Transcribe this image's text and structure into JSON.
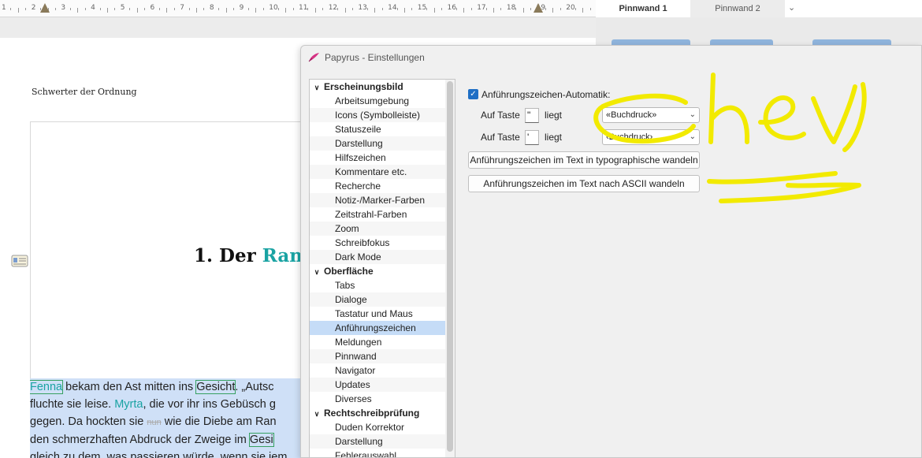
{
  "ruler": {
    "labels": [
      "1",
      "2",
      "3",
      "4",
      "5",
      "6",
      "7",
      "8",
      "9",
      "10",
      "11",
      "12",
      "13",
      "14",
      "15",
      "16",
      "17",
      "18",
      "19",
      "20"
    ]
  },
  "pinnwand": {
    "tab1": "Pinnwand 1",
    "tab2": "Pinnwand 2",
    "chevron_icon": "chevron-down-icon"
  },
  "document": {
    "header": "Schwerter der Ordnung",
    "chapter_prefix": "1. Der ",
    "chapter_teal": "Rand",
    "body_lines": [
      {
        "parts": [
          [
            "Fenna",
            "name boxed"
          ],
          [
            " bekam den Ast mitten ins ",
            ""
          ],
          [
            "Gesicht",
            "boxed"
          ],
          [
            ". „Autsc",
            ""
          ]
        ]
      },
      {
        "parts": [
          [
            "fluchte sie leise. ",
            ""
          ],
          [
            "Myrta",
            "name"
          ],
          [
            ", die vor ihr ins Gebüsch g",
            ""
          ]
        ]
      },
      {
        "parts": [
          [
            "gegen. Da hockten sie ",
            ""
          ],
          [
            "nun",
            "strike"
          ],
          [
            " wie die Diebe am Ran",
            ""
          ]
        ]
      },
      {
        "parts": [
          [
            "den schmerzhaften Abdruck der Zweige im ",
            ""
          ],
          [
            "Gesi",
            "boxed"
          ]
        ]
      },
      {
        "parts": [
          [
            "gleich zu dem, was passieren würde, wenn sie jem",
            ""
          ]
        ]
      }
    ]
  },
  "dialog": {
    "title": "Papyrus - Einstellungen",
    "tree": [
      {
        "type": "category",
        "label": "Erscheinungsbild"
      },
      {
        "type": "item",
        "label": "Arbeitsumgebung"
      },
      {
        "type": "item",
        "label": "Icons (Symbolleiste)"
      },
      {
        "type": "item",
        "label": "Statuszeile"
      },
      {
        "type": "item",
        "label": "Darstellung"
      },
      {
        "type": "item",
        "label": "Hilfszeichen"
      },
      {
        "type": "item",
        "label": "Kommentare etc."
      },
      {
        "type": "item",
        "label": "Recherche"
      },
      {
        "type": "item",
        "label": "Notiz-/Marker-Farben"
      },
      {
        "type": "item",
        "label": "Zeitstrahl-Farben"
      },
      {
        "type": "item",
        "label": "Zoom"
      },
      {
        "type": "item",
        "label": "Schreibfokus"
      },
      {
        "type": "item",
        "label": "Dark Mode"
      },
      {
        "type": "category",
        "label": "Oberfläche"
      },
      {
        "type": "item",
        "label": "Tabs"
      },
      {
        "type": "item",
        "label": "Dialoge"
      },
      {
        "type": "item",
        "label": "Tastatur und Maus"
      },
      {
        "type": "item",
        "label": "Anführungszeichen",
        "selected": true
      },
      {
        "type": "item",
        "label": "Meldungen"
      },
      {
        "type": "item",
        "label": "Pinnwand"
      },
      {
        "type": "item",
        "label": "Navigator"
      },
      {
        "type": "item",
        "label": "Updates"
      },
      {
        "type": "item",
        "label": "Diverses"
      },
      {
        "type": "category",
        "label": "Rechtschreibprüfung"
      },
      {
        "type": "item",
        "label": "Duden Korrektor"
      },
      {
        "type": "item",
        "label": "Darstellung"
      },
      {
        "type": "item",
        "label": "Fehlerauswahl"
      }
    ],
    "settings": {
      "checkbox_label": "Anführungszeichen-Automatik:",
      "checkbox_checked": true,
      "key1": {
        "label": "Auf Taste",
        "key": "\"",
        "liegt": "liegt",
        "value": "«Buchdruck»"
      },
      "key2": {
        "label": "Auf Taste",
        "key": "'",
        "liegt": "liegt",
        "value": "‹Buchdruck›"
      },
      "btn_typo": "Anführungszeichen im Text in typographische wandeln",
      "btn_ascii": "Anführungszeichen im Text nach ASCII wandeln"
    }
  },
  "colors": {
    "accent": "#1f6fc5",
    "teal": "#1aa3a3",
    "selection": "#c5dcf7",
    "scribble": "#f2ea00"
  }
}
